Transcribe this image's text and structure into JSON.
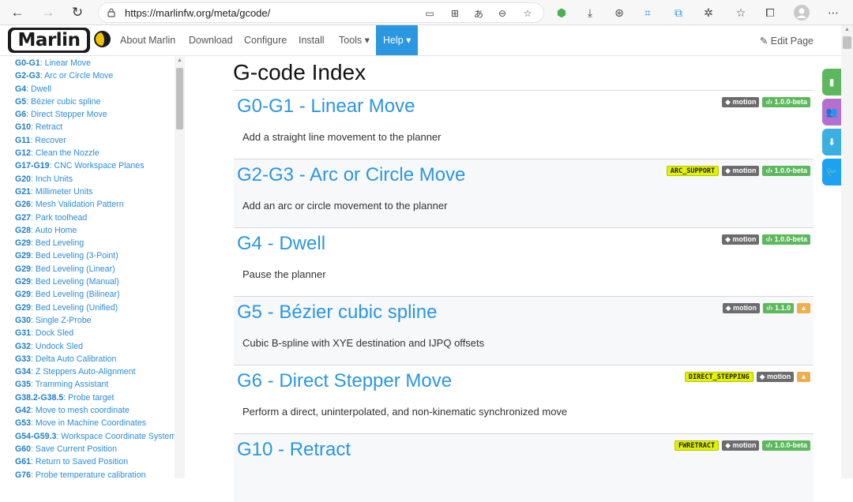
{
  "browser": {
    "url": "https://marlinfw.org/meta/gcode/",
    "back_icon": "←",
    "forward_icon": "→",
    "refresh_icon": "↻"
  },
  "navbar": {
    "logo": "Marlin",
    "items": [
      "About Marlin",
      "Download",
      "Configure",
      "Install",
      "Tools ▾",
      "Help ▾"
    ],
    "edit_page": "✎ Edit Page"
  },
  "sidebar": {
    "items": [
      {
        "code": "G0-G1",
        "label": ": Linear Move"
      },
      {
        "code": "G2-G3",
        "label": ": Arc or Circle Move"
      },
      {
        "code": "G4",
        "label": ": Dwell"
      },
      {
        "code": "G5",
        "label": ": Bézier cubic spline"
      },
      {
        "code": "G6",
        "label": ": Direct Stepper Move"
      },
      {
        "code": "G10",
        "label": ": Retract"
      },
      {
        "code": "G11",
        "label": ": Recover"
      },
      {
        "code": "G12",
        "label": ": Clean the Nozzle"
      },
      {
        "code": "G17-G19",
        "label": ": CNC Workspace Planes"
      },
      {
        "code": "G20",
        "label": ": Inch Units"
      },
      {
        "code": "G21",
        "label": ": Millimeter Units"
      },
      {
        "code": "G26",
        "label": ": Mesh Validation Pattern"
      },
      {
        "code": "G27",
        "label": ": Park toolhead"
      },
      {
        "code": "G28",
        "label": ": Auto Home"
      },
      {
        "code": "G29",
        "label": ": Bed Leveling"
      },
      {
        "code": "G29",
        "label": ": Bed Leveling (3-Point)"
      },
      {
        "code": "G29",
        "label": ": Bed Leveling (Linear)"
      },
      {
        "code": "G29",
        "label": ": Bed Leveling (Manual)"
      },
      {
        "code": "G29",
        "label": ": Bed Leveling (Bilinear)"
      },
      {
        "code": "G29",
        "label": ": Bed Leveling (Unified)"
      },
      {
        "code": "G30",
        "label": ": Single Z-Probe"
      },
      {
        "code": "G31",
        "label": ": Dock Sled"
      },
      {
        "code": "G32",
        "label": ": Undock Sled"
      },
      {
        "code": "G33",
        "label": ": Delta Auto Calibration"
      },
      {
        "code": "G34",
        "label": ": Z Steppers Auto-Alignment"
      },
      {
        "code": "G35",
        "label": ": Tramming Assistant"
      },
      {
        "code": "G38.2-G38.5",
        "label": ": Probe target"
      },
      {
        "code": "G42",
        "label": ": Move to mesh coordinate"
      },
      {
        "code": "G53",
        "label": ": Move in Machine Coordinates"
      },
      {
        "code": "G54-G59.3",
        "label": ": Workspace Coordinate System"
      },
      {
        "code": "G60",
        "label": ": Save Current Position"
      },
      {
        "code": "G61",
        "label": ": Return to Saved Position"
      },
      {
        "code": "G76",
        "label": ": Probe temperature calibration"
      }
    ]
  },
  "main": {
    "title": "G-code Index",
    "entries": [
      {
        "title": "G0-G1 - Linear Move",
        "desc": "Add a straight line movement to the planner",
        "tags": [
          {
            "text": "◆ motion",
            "kind": "gray"
          },
          {
            "text": "‹/› 1.0.0-beta",
            "kind": "green"
          }
        ]
      },
      {
        "title": "G2-G3 - Arc or Circle Move",
        "desc": "Add an arc or circle movement to the planner",
        "tags": [
          {
            "text": "ARC_SUPPORT",
            "kind": "yellow"
          },
          {
            "text": "◆ motion",
            "kind": "gray"
          },
          {
            "text": "‹/› 1.0.0-beta",
            "kind": "green"
          }
        ]
      },
      {
        "title": "G4 - Dwell",
        "desc": "Pause the planner",
        "tags": [
          {
            "text": "◆ motion",
            "kind": "gray"
          },
          {
            "text": "‹/› 1.0.0-beta",
            "kind": "green"
          }
        ]
      },
      {
        "title": "G5 - Bézier cubic spline",
        "desc": "Cubic B-spline with XYE destination and IJPQ offsets",
        "tags": [
          {
            "text": "◆ motion",
            "kind": "gray"
          },
          {
            "text": "‹/› 1.1.0",
            "kind": "green"
          },
          {
            "text": "▲",
            "kind": "orange"
          }
        ]
      },
      {
        "title": "G6 - Direct Stepper Move",
        "desc": "Perform a direct, uninterpolated, and non-kinematic synchronized move",
        "tags": [
          {
            "text": "DIRECT_STEPPING",
            "kind": "yellow"
          },
          {
            "text": "◆ motion",
            "kind": "gray"
          },
          {
            "text": "▲",
            "kind": "orange"
          }
        ]
      },
      {
        "title": "G10 - Retract",
        "desc": "",
        "tags": [
          {
            "text": "FWRETRACT",
            "kind": "yellow"
          },
          {
            "text": "◆ motion",
            "kind": "gray"
          },
          {
            "text": "‹/› 1.0.0-beta",
            "kind": "green"
          }
        ]
      }
    ]
  },
  "floating_tabs": [
    {
      "icon": "book-icon",
      "color": "#5cb85c",
      "glyph": "▮"
    },
    {
      "icon": "people-icon",
      "color": "#b56fcf",
      "glyph": "👥"
    },
    {
      "icon": "download-icon",
      "color": "#3bb0e0",
      "glyph": "⬇"
    },
    {
      "icon": "twitter-icon",
      "color": "#1da1f2",
      "glyph": "🐦"
    }
  ]
}
